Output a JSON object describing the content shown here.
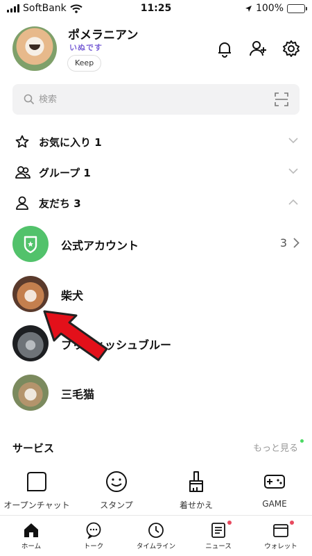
{
  "status_bar": {
    "carrier": "SoftBank",
    "time": "11:25",
    "battery": "100%"
  },
  "profile": {
    "name": "ポメラニアン",
    "status_message": "いぬです",
    "keep_label": "Keep"
  },
  "search": {
    "placeholder": "検索"
  },
  "sections": {
    "favorites": "お気に入り 1",
    "groups": "グループ 1",
    "friends": "友だち 3"
  },
  "friends": [
    {
      "name": "公式アカウント",
      "count": "3"
    },
    {
      "name": "柴犬"
    },
    {
      "name": "ブリティッシュブルー"
    },
    {
      "name": "三毛猫"
    }
  ],
  "services": {
    "title": "サービス",
    "more": "もっと見る",
    "items": [
      {
        "label": "オープンチャット",
        "icon": "open-chat-icon"
      },
      {
        "label": "スタンプ",
        "icon": "sticker-icon"
      },
      {
        "label": "着せかえ",
        "icon": "theme-icon"
      },
      {
        "label": "GAME",
        "icon": "game-icon"
      }
    ]
  },
  "nav": {
    "tabs": [
      {
        "label": "ホーム",
        "icon": "home-icon"
      },
      {
        "label": "トーク",
        "icon": "chat-icon"
      },
      {
        "label": "タイムライン",
        "icon": "clock-icon"
      },
      {
        "label": "ニュース",
        "icon": "news-icon"
      },
      {
        "label": "ウォレット",
        "icon": "wallet-icon"
      }
    ]
  },
  "colors": {
    "accent_green": "#4cd964",
    "official_green": "#52c26b",
    "badge_red": "#e84a5f",
    "arrow_red": "#e3101a"
  }
}
